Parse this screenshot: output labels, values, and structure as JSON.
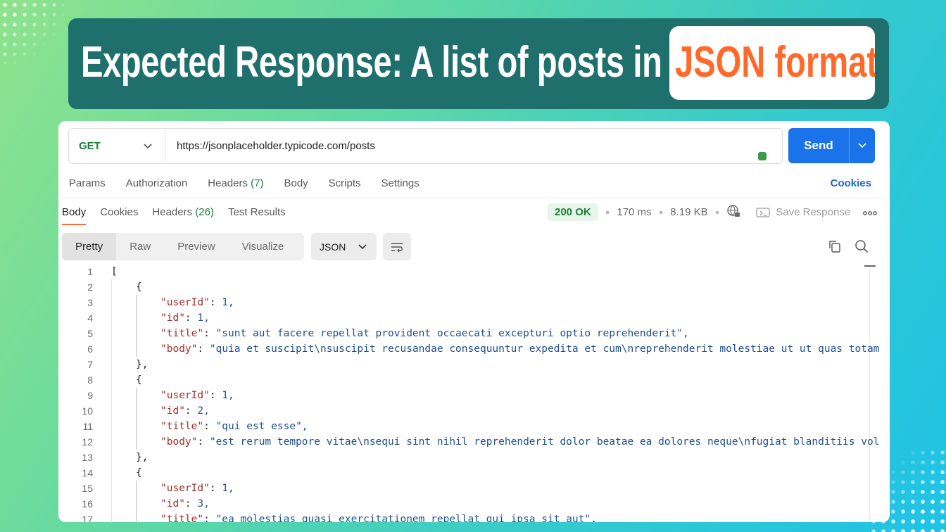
{
  "banner": {
    "title": "Expected Response: A list of posts in",
    "highlight": "JSON format"
  },
  "request": {
    "method": "GET",
    "url": "https://jsonplaceholder.typicode.com/posts",
    "send_label": "Send"
  },
  "request_tabs": {
    "params": "Params",
    "authorization": "Authorization",
    "headers": "Headers",
    "headers_count": "(7)",
    "body": "Body",
    "scripts": "Scripts",
    "settings": "Settings",
    "cookies": "Cookies"
  },
  "response_tabs": {
    "body": "Body",
    "cookies": "Cookies",
    "headers": "Headers",
    "headers_count": "(26)",
    "test_results": "Test Results"
  },
  "status": {
    "code": "200 OK",
    "time": "170 ms",
    "size": "8.19 KB",
    "save_response": "Save Response"
  },
  "view_options": {
    "pretty": "Pretty",
    "raw": "Raw",
    "preview": "Preview",
    "visualize": "Visualize",
    "format": "JSON"
  },
  "colors": {
    "accent": "#1a73e8",
    "method": "#1a7f37",
    "highlight": "#ff6a2b",
    "banner_bg": "#1f6f6c"
  },
  "code_lines": [
    {
      "n": "1",
      "text": "["
    },
    {
      "n": "2",
      "text": "{"
    },
    {
      "n": "3",
      "key": "\"userId\"",
      "val": "1,"
    },
    {
      "n": "4",
      "key": "\"id\"",
      "val": "1,"
    },
    {
      "n": "5",
      "key": "\"title\"",
      "val": "\"sunt aut facere repellat provident occaecati excepturi optio reprehenderit\","
    },
    {
      "n": "6",
      "key": "\"body\"",
      "val": "\"quia et suscipit\\nsuscipit recusandae consequuntur expedita et cum\\nreprehenderit molestiae ut ut quas totam"
    },
    {
      "n": "7",
      "text": "},"
    },
    {
      "n": "8",
      "text": "{"
    },
    {
      "n": "9",
      "key": "\"userId\"",
      "val": "1,"
    },
    {
      "n": "10",
      "key": "\"id\"",
      "val": "2,"
    },
    {
      "n": "11",
      "key": "\"title\"",
      "val": "\"qui est esse\","
    },
    {
      "n": "12",
      "key": "\"body\"",
      "val": "\"est rerum tempore vitae\\nsequi sint nihil reprehenderit dolor beatae ea dolores neque\\nfugiat blanditiis vol"
    },
    {
      "n": "13",
      "text": "},"
    },
    {
      "n": "14",
      "text": "{"
    },
    {
      "n": "15",
      "key": "\"userId\"",
      "val": "1,"
    },
    {
      "n": "16",
      "key": "\"id\"",
      "val": "3,"
    },
    {
      "n": "17",
      "key": "\"title\"",
      "val": "\"ea molestias quasi exercitationem repellat qui ipsa sit aut\","
    }
  ]
}
